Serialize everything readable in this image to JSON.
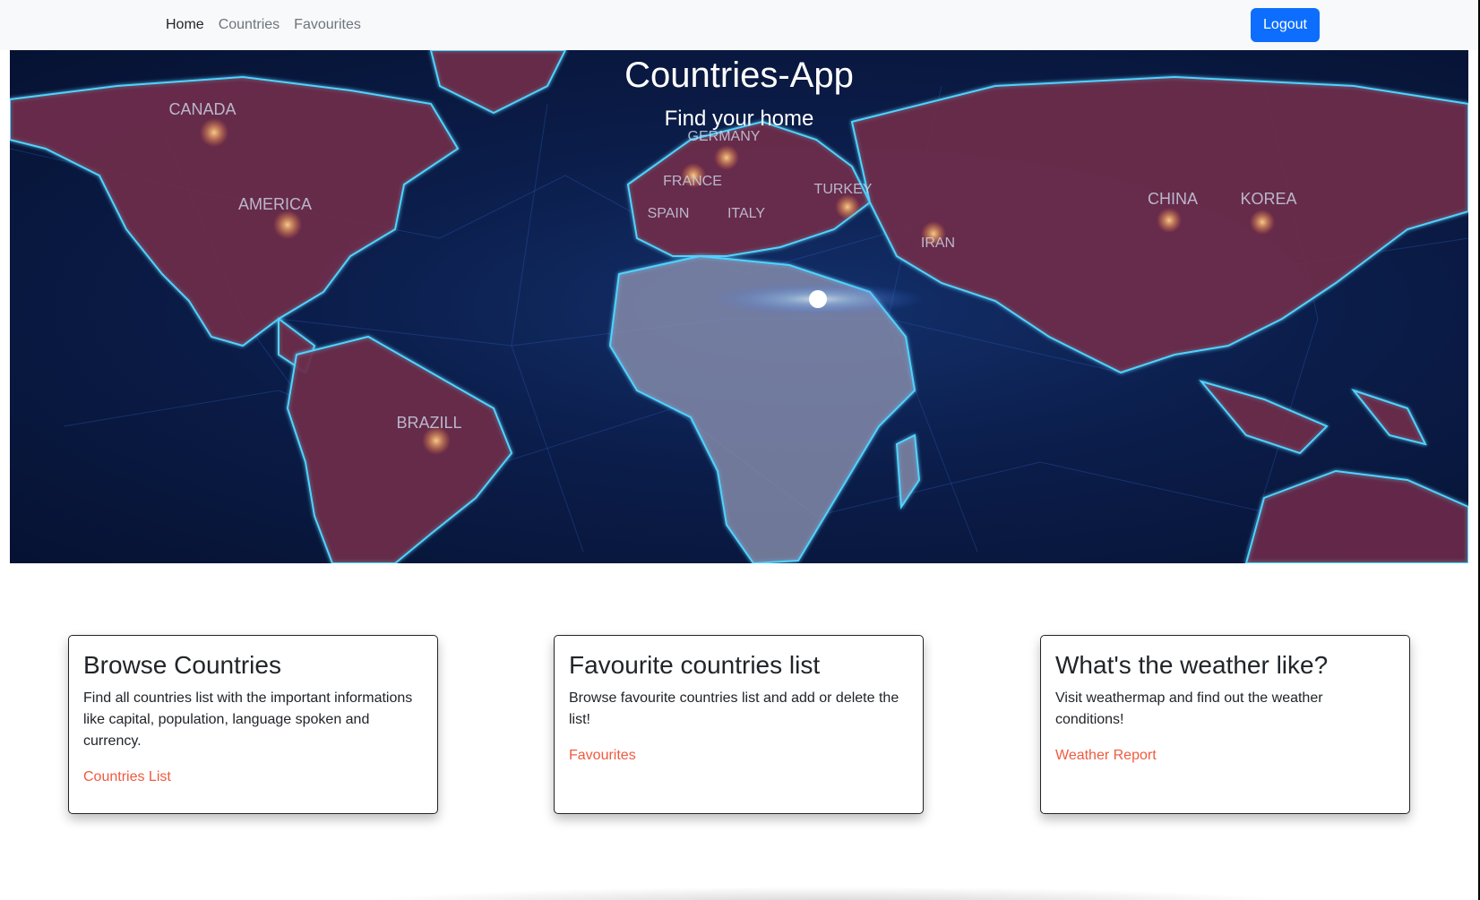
{
  "nav": {
    "items": [
      {
        "label": "Home",
        "active": true
      },
      {
        "label": "Countries",
        "active": false
      },
      {
        "label": "Favourites",
        "active": false
      }
    ],
    "logout_label": "Logout"
  },
  "hero": {
    "title": "Countries-App",
    "subtitle": "Find your home",
    "map_labels": [
      "CANADA",
      "AMERICA",
      "BRAZILL",
      "GERMANY",
      "FRANCE",
      "SPAIN",
      "ITALY",
      "TURKEY",
      "IRAN",
      "CHINA",
      "KOREA"
    ]
  },
  "cards": [
    {
      "title": "Browse Countries",
      "text": "Find all countries list with the important informations like capital, population, language spoken and currency.",
      "link": "Countries List"
    },
    {
      "title": "Favourite countries list",
      "text": "Browse favourite countries list and add or delete the list!",
      "link": "Favourites"
    },
    {
      "title": "What's the weather like?",
      "text": "Visit weathermap and find out the weather conditions!",
      "link": "Weather Report"
    }
  ],
  "colors": {
    "primary": "#0d6efd",
    "link": "#f05a3f",
    "navbar_bg": "#f8f9fa",
    "hero_bg": "#0b1d4a",
    "land": "#6b2b4a",
    "border_glow": "#4fd3ff"
  }
}
